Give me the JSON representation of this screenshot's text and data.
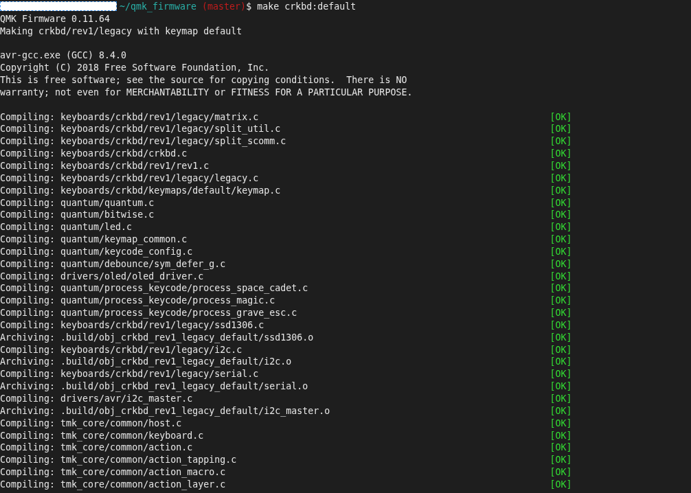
{
  "prompt": {
    "path": "~/qmk_firmware",
    "branch": "(master)",
    "symbol": "$",
    "command": "make crkbd:default"
  },
  "lines": [
    {
      "kind": "text",
      "text": "QMK Firmware 0.11.64"
    },
    {
      "kind": "text",
      "text": "Making crkbd/rev1/legacy with keymap default"
    },
    {
      "kind": "blank"
    },
    {
      "kind": "text",
      "text": "avr-gcc.exe (GCC) 8.4.0"
    },
    {
      "kind": "text",
      "text": "Copyright (C) 2018 Free Software Foundation, Inc."
    },
    {
      "kind": "text",
      "text": "This is free software; see the source for copying conditions.  There is NO"
    },
    {
      "kind": "text",
      "text": "warranty; not even for MERCHANTABILITY or FITNESS FOR A PARTICULAR PURPOSE."
    },
    {
      "kind": "blank"
    },
    {
      "kind": "step",
      "text": "Compiling: keyboards/crkbd/rev1/legacy/matrix.c",
      "status": "[OK]"
    },
    {
      "kind": "step",
      "text": "Compiling: keyboards/crkbd/rev1/legacy/split_util.c",
      "status": "[OK]"
    },
    {
      "kind": "step",
      "text": "Compiling: keyboards/crkbd/rev1/legacy/split_scomm.c",
      "status": "[OK]"
    },
    {
      "kind": "step",
      "text": "Compiling: keyboards/crkbd/crkbd.c",
      "status": "[OK]"
    },
    {
      "kind": "step",
      "text": "Compiling: keyboards/crkbd/rev1/rev1.c",
      "status": "[OK]"
    },
    {
      "kind": "step",
      "text": "Compiling: keyboards/crkbd/rev1/legacy/legacy.c",
      "status": "[OK]"
    },
    {
      "kind": "step",
      "text": "Compiling: keyboards/crkbd/keymaps/default/keymap.c",
      "status": "[OK]"
    },
    {
      "kind": "step",
      "text": "Compiling: quantum/quantum.c",
      "status": "[OK]"
    },
    {
      "kind": "step",
      "text": "Compiling: quantum/bitwise.c",
      "status": "[OK]"
    },
    {
      "kind": "step",
      "text": "Compiling: quantum/led.c",
      "status": "[OK]"
    },
    {
      "kind": "step",
      "text": "Compiling: quantum/keymap_common.c",
      "status": "[OK]"
    },
    {
      "kind": "step",
      "text": "Compiling: quantum/keycode_config.c",
      "status": "[OK]"
    },
    {
      "kind": "step",
      "text": "Compiling: quantum/debounce/sym_defer_g.c",
      "status": "[OK]"
    },
    {
      "kind": "step",
      "text": "Compiling: drivers/oled/oled_driver.c",
      "status": "[OK]"
    },
    {
      "kind": "step",
      "text": "Compiling: quantum/process_keycode/process_space_cadet.c",
      "status": "[OK]"
    },
    {
      "kind": "step",
      "text": "Compiling: quantum/process_keycode/process_magic.c",
      "status": "[OK]"
    },
    {
      "kind": "step",
      "text": "Compiling: quantum/process_keycode/process_grave_esc.c",
      "status": "[OK]"
    },
    {
      "kind": "step",
      "text": "Compiling: keyboards/crkbd/rev1/legacy/ssd1306.c",
      "status": "[OK]"
    },
    {
      "kind": "step",
      "text": "Archiving: .build/obj_crkbd_rev1_legacy_default/ssd1306.o",
      "status": "[OK]"
    },
    {
      "kind": "step",
      "text": "Compiling: keyboards/crkbd/rev1/legacy/i2c.c",
      "status": "[OK]"
    },
    {
      "kind": "step",
      "text": "Archiving: .build/obj_crkbd_rev1_legacy_default/i2c.o",
      "status": "[OK]"
    },
    {
      "kind": "step",
      "text": "Compiling: keyboards/crkbd/rev1/legacy/serial.c",
      "status": "[OK]"
    },
    {
      "kind": "step",
      "text": "Archiving: .build/obj_crkbd_rev1_legacy_default/serial.o",
      "status": "[OK]"
    },
    {
      "kind": "step",
      "text": "Compiling: drivers/avr/i2c_master.c",
      "status": "[OK]"
    },
    {
      "kind": "step",
      "text": "Archiving: .build/obj_crkbd_rev1_legacy_default/i2c_master.o",
      "status": "[OK]"
    },
    {
      "kind": "step",
      "text": "Compiling: tmk_core/common/host.c",
      "status": "[OK]"
    },
    {
      "kind": "step",
      "text": "Compiling: tmk_core/common/keyboard.c",
      "status": "[OK]"
    },
    {
      "kind": "step",
      "text": "Compiling: tmk_core/common/action.c",
      "status": "[OK]"
    },
    {
      "kind": "step",
      "text": "Compiling: tmk_core/common/action_tapping.c",
      "status": "[OK]"
    },
    {
      "kind": "step",
      "text": "Compiling: tmk_core/common/action_macro.c",
      "status": "[OK]"
    },
    {
      "kind": "step",
      "text": "Compiling: tmk_core/common/action_layer.c",
      "status": "[OK]"
    }
  ]
}
